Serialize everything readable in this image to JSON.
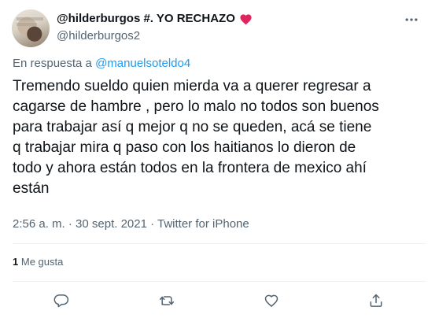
{
  "author": {
    "display_name": "@hilderburgos #. YO RECHAZO",
    "handle": "@hilderburgos2",
    "heart_color": "#e0245e"
  },
  "reply": {
    "prefix": "En respuesta a",
    "to_handle": "@manuelsoteldo4"
  },
  "tweet": {
    "text": "Tremendo sueldo quien mierda va a querer regresar a\ncagarse de hambre , pero lo malo no todos son buenos\npara trabajar así q mejor q no se queden, acá se tiene\nq trabajar mira q paso con los haitianos lo dieron de\ntodo y ahora están todos en la frontera de mexico ahí\nestán",
    "meta": "2:56 a. m. · 30 sept. 2021 · Twitter for iPhone"
  },
  "stats": {
    "likes_count": "1",
    "likes_label": "Me gusta"
  },
  "colors": {
    "link": "#1d9bf0",
    "secondary_text": "#536471",
    "icon": "#536471"
  },
  "icons": {
    "more": "more-horizontal-icon",
    "reply": "reply-icon",
    "retweet": "retweet-icon",
    "like": "heart-outline-icon",
    "share": "share-icon"
  }
}
